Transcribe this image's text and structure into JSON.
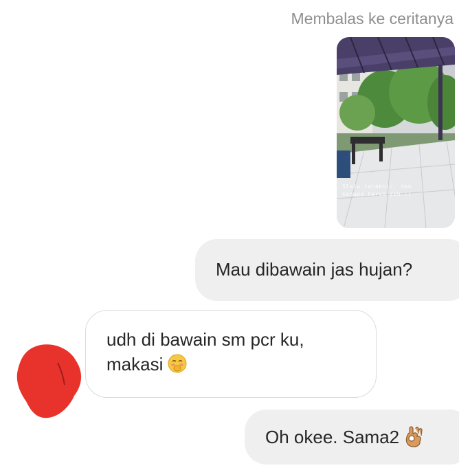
{
  "story_reply": {
    "label": "Membalas ke ceritanya",
    "thumbnail_caption": [
      "Slalu terakhir, dan",
      "kenapa harus sih :("
    ]
  },
  "messages": [
    {
      "sender": "me",
      "text": "Mau dibawain jas hujan?"
    },
    {
      "sender": "them",
      "lines": [
        "udh di bawain sm pcr ku,",
        "makasi"
      ],
      "emoji": "blushing-face-emoji"
    },
    {
      "sender": "me",
      "text": "Oh okee. Sama2",
      "emoji": "ok-hand-emoji"
    }
  ],
  "colors": {
    "sent_bubble": "#efefef",
    "received_bubble_border": "#dbdbdb",
    "text": "#262626",
    "muted_text": "#8e8e8e",
    "avatar_redaction": "#e8332c"
  }
}
